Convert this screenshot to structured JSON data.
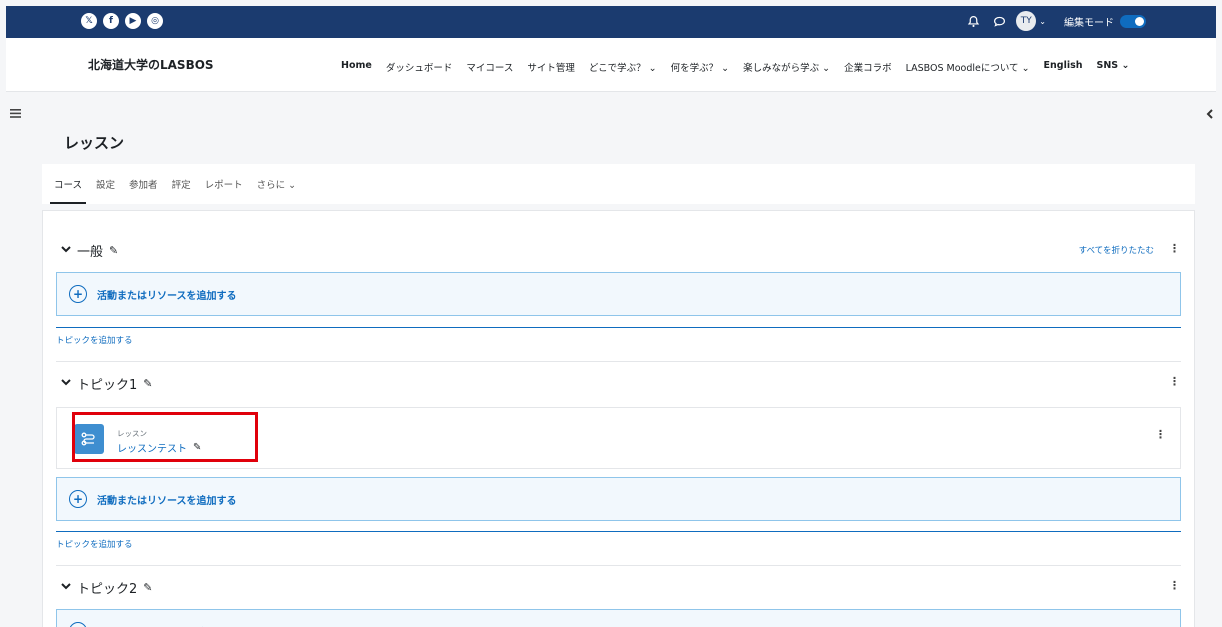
{
  "topbar": {
    "social": [
      {
        "icon": "x-icon",
        "glyph": "𝕏"
      },
      {
        "icon": "facebook-icon",
        "glyph": "f"
      },
      {
        "icon": "youtube-icon",
        "glyph": "▶"
      },
      {
        "icon": "instagram-icon",
        "glyph": "◎"
      }
    ],
    "avatar_initials": "TY",
    "edit_mode_label": "編集モード",
    "edit_mode_on": true,
    "background": "#1b3b6f"
  },
  "navbar": {
    "brand": "北海道大学のLASBOS",
    "items": [
      {
        "label": "Home",
        "strong": true
      },
      {
        "label": "ダッシュボード"
      },
      {
        "label": "マイコース"
      },
      {
        "label": "サイト管理"
      },
      {
        "label": "どこで学ぶ？ ⌄"
      },
      {
        "label": "何を学ぶ？ ⌄"
      },
      {
        "label": "楽しみながら学ぶ ⌄"
      },
      {
        "label": "企業コラボ"
      },
      {
        "label": "LASBOS Moodleについて ⌄"
      },
      {
        "label": "English",
        "strong": true
      },
      {
        "label": "SNS ⌄",
        "strong": true
      }
    ]
  },
  "page": {
    "title": "レッスン",
    "tabs": [
      "コース",
      "設定",
      "参加者",
      "評定",
      "レポート",
      "さらに ⌄"
    ],
    "active_tab": 0
  },
  "sections": {
    "collapse_all": "すべてを折りたたむ",
    "general_title": "一般",
    "add_activity": "活動またはリソースを追加する",
    "add_topic": "トピックを追加する",
    "topic1_title": "トピック1",
    "topic2_title": "トピック2",
    "activity": {
      "type": "レッスン",
      "name": "レッスンテスト"
    }
  },
  "colors": {
    "link": "#0f6cbf",
    "highlight": "#e0000b"
  }
}
